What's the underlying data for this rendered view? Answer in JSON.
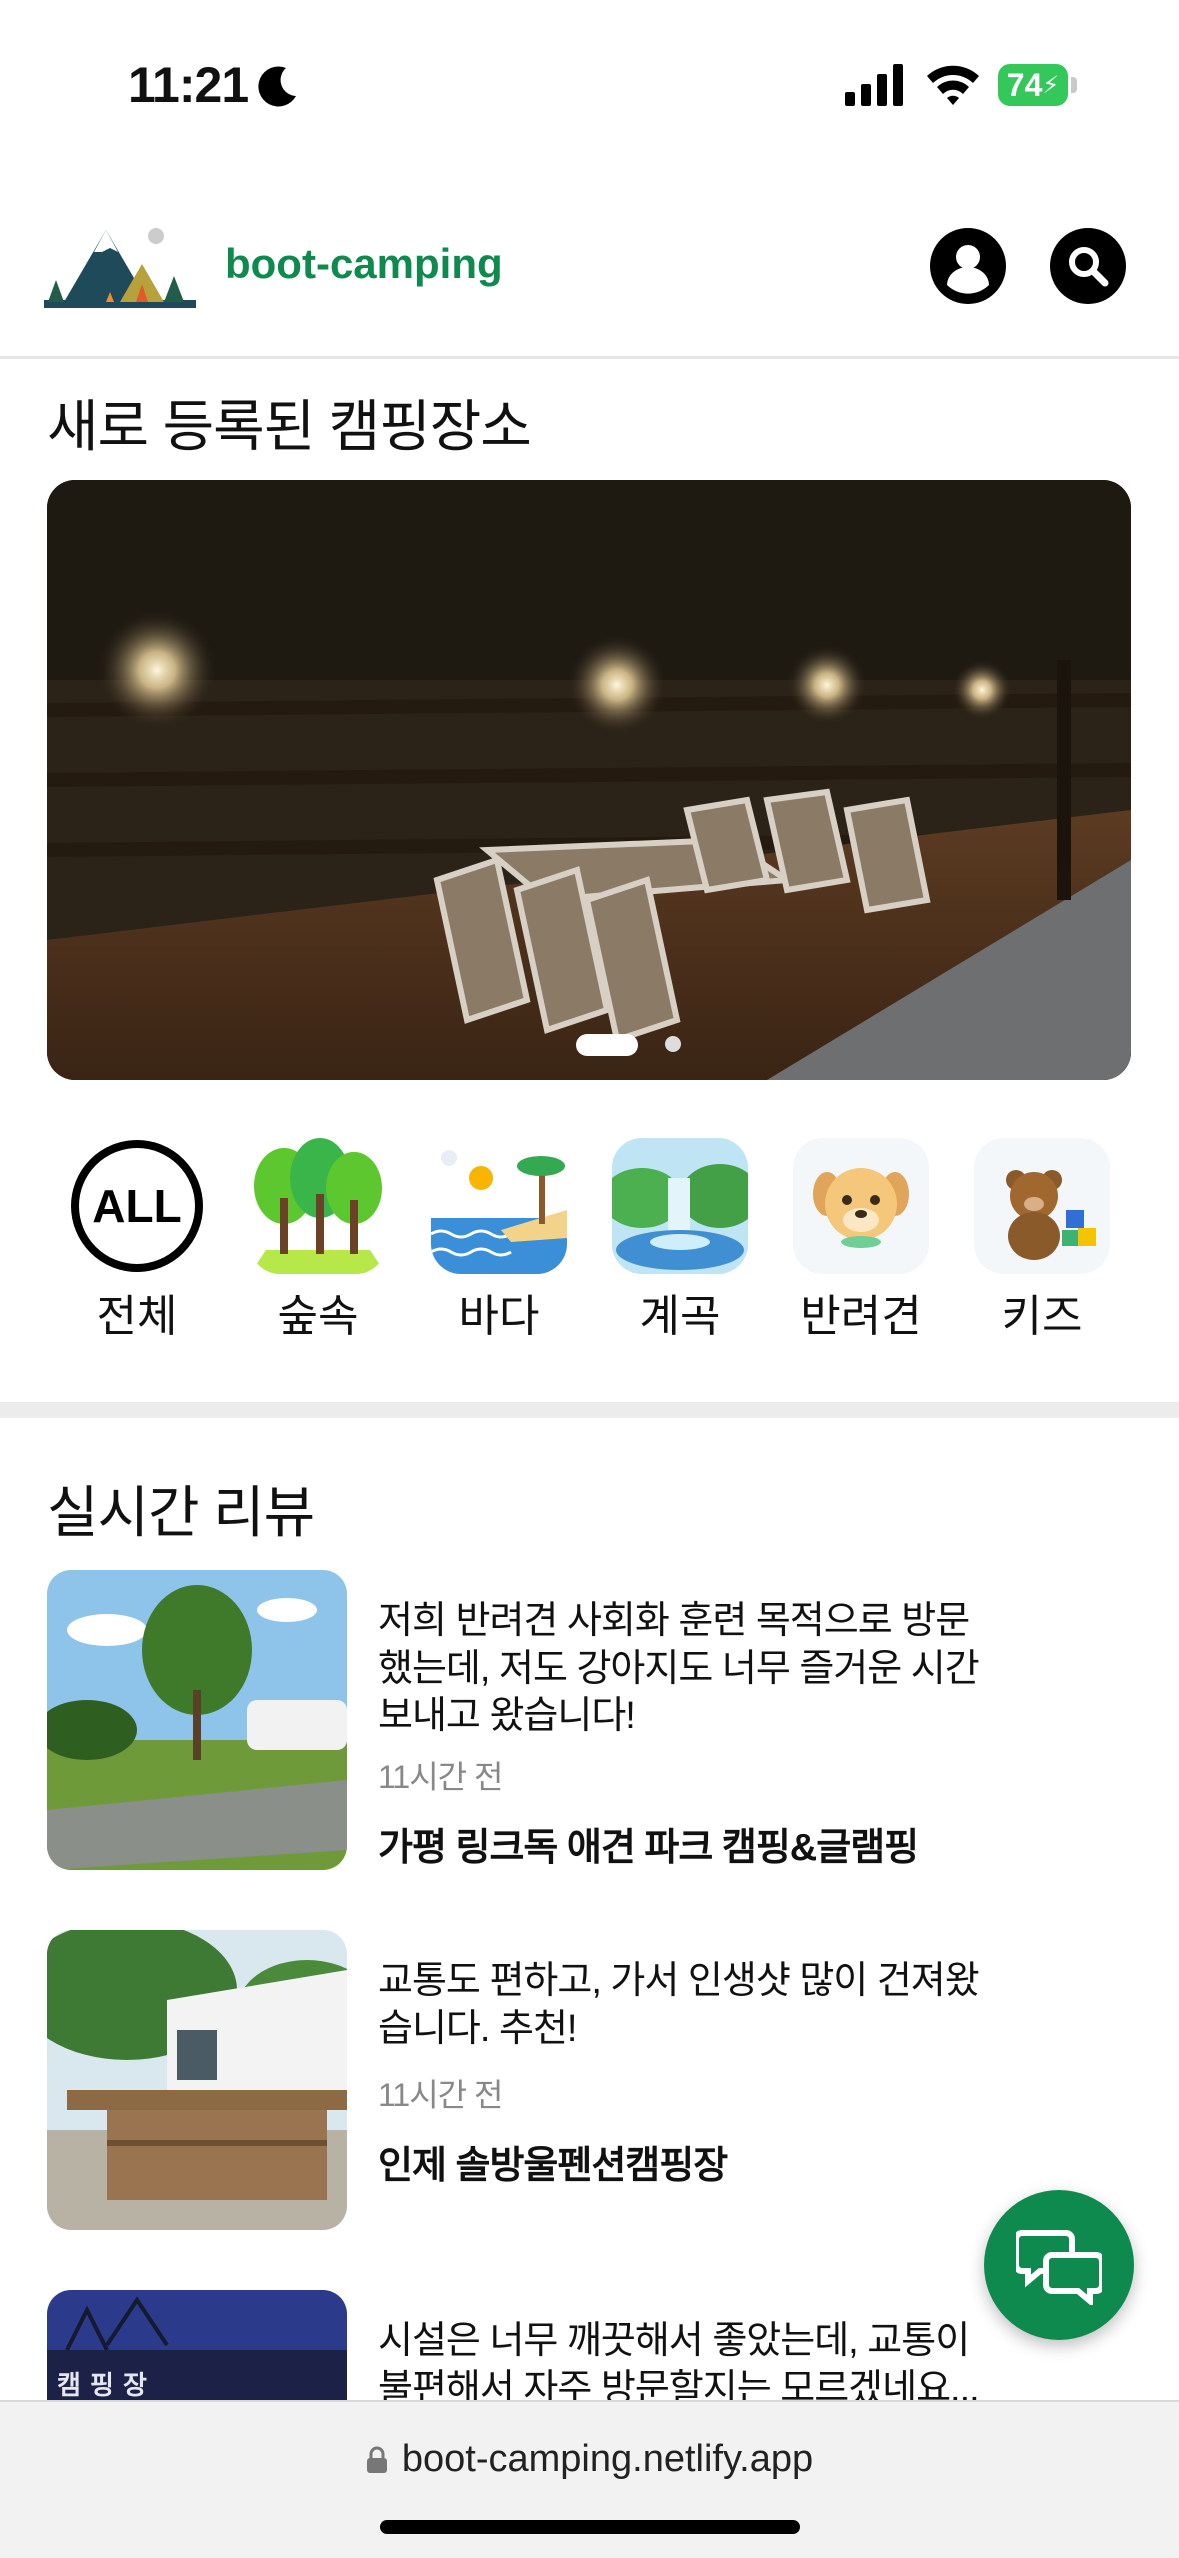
{
  "status_bar": {
    "time": "11:21",
    "battery": "74"
  },
  "header": {
    "brand": "boot-camping",
    "profile_icon": "user-icon",
    "search_icon": "search-icon"
  },
  "new_section": {
    "title": "새로 등록된 캠핑장소",
    "slides": 2,
    "active_slide": 1
  },
  "categories": [
    {
      "label": "전체",
      "icon": "all-icon"
    },
    {
      "label": "숲속",
      "icon": "forest-icon"
    },
    {
      "label": "바다",
      "icon": "sea-icon"
    },
    {
      "label": "계곡",
      "icon": "valley-icon"
    },
    {
      "label": "반려견",
      "icon": "dog-icon"
    },
    {
      "label": "키즈",
      "icon": "kids-icon"
    }
  ],
  "reviews_section": {
    "title": "실시간 리뷰"
  },
  "reviews": [
    {
      "text": "저희 반려견 사회화 훈련 목적으로 방문했는데, 저도 강아지도 너무 즐거운 시간 보내고 왔습니다!",
      "time": "11시간 전",
      "place": "가평 링크독 애견 파크 캠핑&글램핑"
    },
    {
      "text": "교통도 편하고, 가서 인생샷 많이 건져왔습니다. 추천!",
      "time": "11시간 전",
      "place": "인제 솔방울펜션캠핑장"
    },
    {
      "text": "시설은 너무 깨끗해서 좋았는데, 교통이 불편해서 자주 방문할지는 모르겠네요...",
      "time": "",
      "place": "",
      "image_text": "캠 핑 장"
    }
  ],
  "browser": {
    "url": "boot-camping.netlify.app"
  },
  "colors": {
    "brand": "#0f8a4f",
    "battery": "#34c759"
  }
}
